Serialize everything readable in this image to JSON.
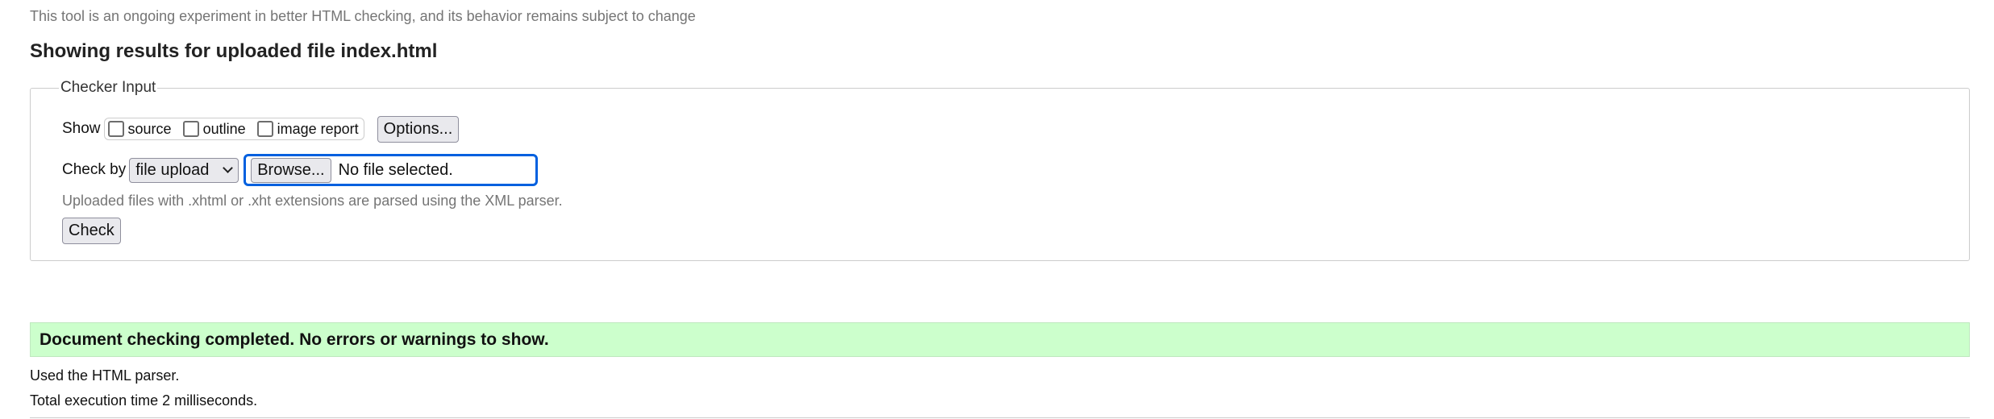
{
  "page": {
    "experiment_note": "This tool is an ongoing experiment in better HTML checking, and its behavior remains subject to change",
    "heading": "Showing results for uploaded file index.html"
  },
  "checker_input": {
    "legend": "Checker Input",
    "show_label": "Show",
    "show_options": [
      {
        "label": "source",
        "checked": false
      },
      {
        "label": "outline",
        "checked": false
      },
      {
        "label": "image report",
        "checked": false
      }
    ],
    "options_button": "Options...",
    "check_by_label": "Check by",
    "check_by_selected": "file upload",
    "browse_button": "Browse...",
    "file_status": "No file selected.",
    "hint": "Uploaded files with .xhtml or .xht extensions are parsed using the XML parser.",
    "check_button": "Check"
  },
  "results": {
    "success_message": "Document checking completed. No errors or warnings to show.",
    "parser_info": "Used the HTML parser.",
    "execution_time": "Total execution time 2 milliseconds."
  },
  "colors": {
    "success_bg": "#ccffcc",
    "focus_ring": "#0060df",
    "muted_text": "#757575"
  }
}
